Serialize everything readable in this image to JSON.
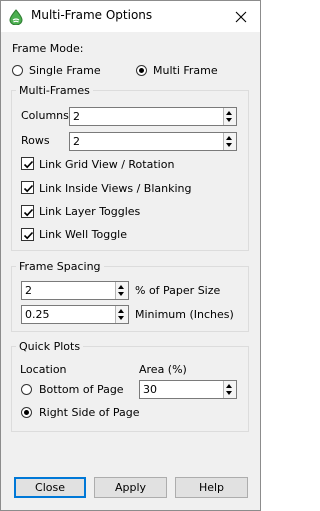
{
  "window": {
    "title": "Multi-Frame Options"
  },
  "frame_mode": {
    "label": "Frame Mode:",
    "options": [
      {
        "label": "Single Frame",
        "selected": false
      },
      {
        "label": "Multi Frame",
        "selected": true
      }
    ]
  },
  "multi_frames": {
    "title": "Multi-Frames",
    "columns": {
      "label": "Columns",
      "value": "2"
    },
    "rows": {
      "label": "Rows",
      "value": "2"
    },
    "checkboxes": [
      {
        "label": "Link Grid View / Rotation",
        "checked": true
      },
      {
        "label": "Link Inside Views / Blanking",
        "checked": true
      },
      {
        "label": "Link Layer Toggles",
        "checked": true
      },
      {
        "label": "Link Well Toggle",
        "checked": true
      }
    ]
  },
  "frame_spacing": {
    "title": "Frame Spacing",
    "spacing": {
      "value": "2",
      "unit_label": "% of Paper Size"
    },
    "minimum": {
      "value": "0.25",
      "unit_label": "Minimum (Inches)"
    }
  },
  "quick_plots": {
    "title": "Quick Plots",
    "location_label": "Location",
    "area_label": "Area (%)",
    "area_value": "30",
    "locations": [
      {
        "label": "Bottom of Page",
        "selected": false
      },
      {
        "label": "Right Side of Page",
        "selected": true
      }
    ]
  },
  "buttons": {
    "close": "Close",
    "apply": "Apply",
    "help": "Help"
  }
}
